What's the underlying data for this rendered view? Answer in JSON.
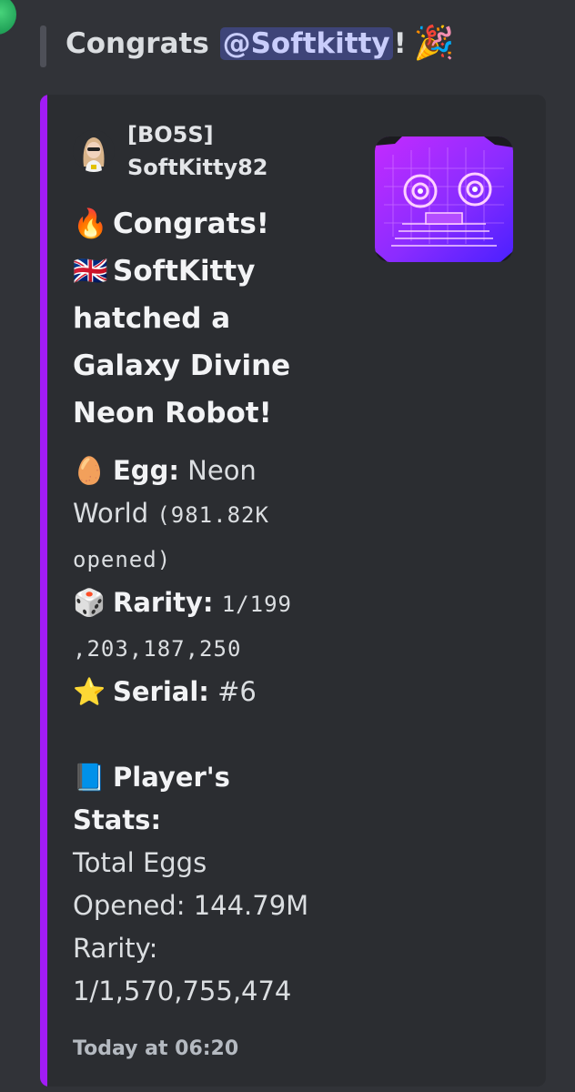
{
  "message": {
    "prefix": "Congrats ",
    "mention": "@Softkitty",
    "suffix": "!",
    "emoji": "🎉"
  },
  "embed": {
    "accent_color": "#a21cf5",
    "author": {
      "tag": "[BO5S]",
      "name": "SoftKitty82"
    },
    "title_lines": [
      {
        "emoji": "🔥",
        "text": "Congrats!"
      },
      {
        "emoji": "🇬🇧",
        "text": "SoftKitty"
      },
      {
        "emoji": "",
        "text": "hatched a"
      },
      {
        "emoji": "",
        "text": "Galaxy Divine"
      },
      {
        "emoji": "",
        "text": "Neon Robot!"
      }
    ],
    "egg": {
      "emoji": "🥚",
      "label": "Egg:",
      "value_line1": "Neon",
      "value_line2": "World",
      "opened_line1": "(981.82K",
      "opened_line2": "opened)"
    },
    "rarity": {
      "emoji": "🎲",
      "label": "Rarity:",
      "value_line1": "1/199",
      "value_line2": ",203,187,250"
    },
    "serial": {
      "emoji": "⭐",
      "label": "Serial:",
      "value": "#6"
    },
    "player_stats": {
      "emoji": "📘",
      "label_line1": "Player's",
      "label_line2": "Stats:",
      "total_eggs_line1": "Total Eggs",
      "total_eggs_line2": "Opened: 144.79M",
      "rarity_line1": "Rarity:",
      "rarity_line2": "1/1,570,755,474"
    },
    "timestamp": "Today at 06:20"
  }
}
